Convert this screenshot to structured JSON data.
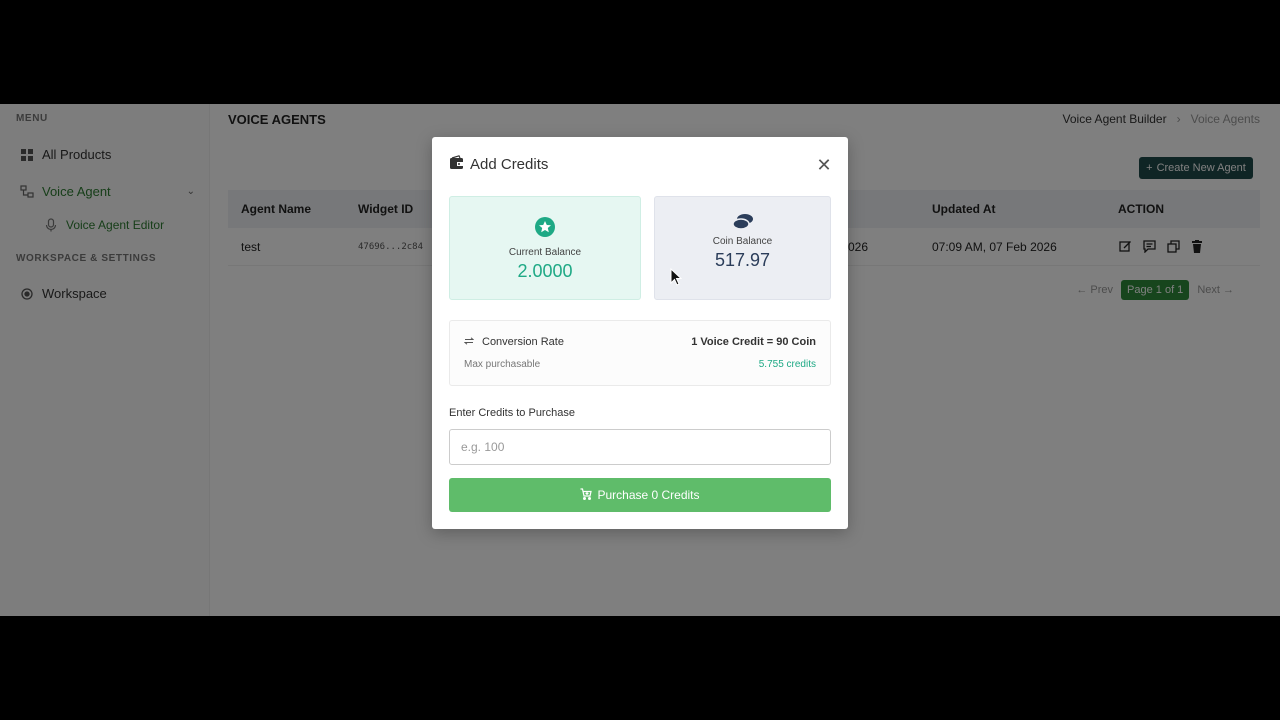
{
  "sidebar": {
    "menu_label": "MENU",
    "items": [
      {
        "label": "All Products",
        "icon": "grid-icon"
      },
      {
        "label": "Voice Agent",
        "icon": "folder-tree-icon",
        "active": true
      },
      {
        "label": "Voice Agent Editor",
        "icon": "microphone-icon"
      }
    ],
    "section2_label": "WORKSPACE & SETTINGS",
    "workspace": {
      "label": "Workspace",
      "icon": "target-icon"
    }
  },
  "header": {
    "title": "VOICE AGENTS",
    "breadcrumb": [
      "Voice Agent Builder",
      "Voice Agents"
    ]
  },
  "toolbar": {
    "create_label": "Create New Agent"
  },
  "table": {
    "columns": [
      "Agent Name",
      "Widget ID",
      "Updated At",
      "ACTION"
    ],
    "rows": [
      {
        "name": "test",
        "widget_id": "47696...2c84",
        "created_partial": "026",
        "updated_at": "07:09 AM, 07 Feb 2026"
      }
    ]
  },
  "pager": {
    "prev": "Prev",
    "page": "Page 1 of 1",
    "next": "Next"
  },
  "modal": {
    "title": "Add Credits",
    "current_balance": {
      "label": "Current Balance",
      "value": "2.0000"
    },
    "coin_balance": {
      "label": "Coin Balance",
      "value": "517.97"
    },
    "conversion": {
      "label": "Conversion Rate",
      "rate": "1 Voice Credit = 90 Coin",
      "max_label": "Max purchasable",
      "max_value": "5.755 credits"
    },
    "input_label": "Enter Credits to Purchase",
    "input_placeholder": "e.g. 100",
    "purchase_label": "Purchase 0 Credits"
  },
  "colors": {
    "accent_green": "#2e8b3a",
    "teal": "#1ea985",
    "dark_teal": "#1f4a4a",
    "purchase_green": "#5fbc6a"
  }
}
